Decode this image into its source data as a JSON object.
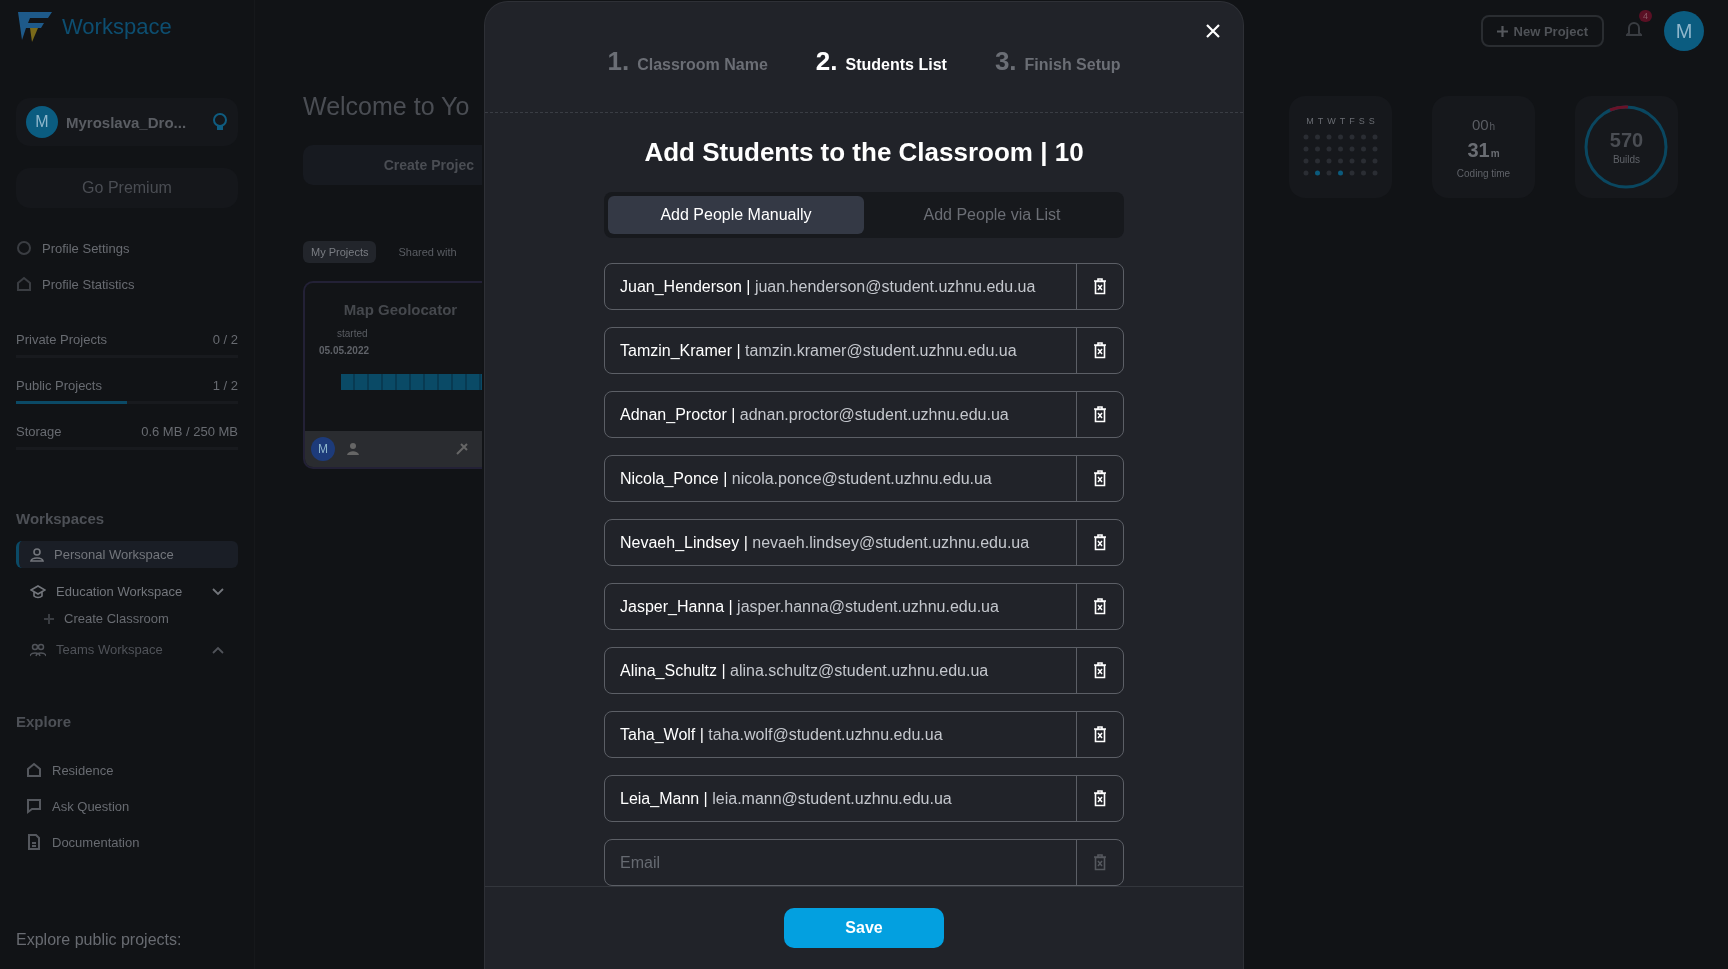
{
  "sidebar": {
    "logo": "Workspace",
    "user": {
      "avatar": "M",
      "name": "Myroslava_Dro..."
    },
    "premium": "Go Premium",
    "profile_links": [
      {
        "label": "Profile Settings",
        "kind": "settings"
      },
      {
        "label": "Profile Statistics",
        "kind": "stats"
      }
    ],
    "quotas": [
      {
        "label": "Private Projects",
        "value": "0 / 2"
      },
      {
        "label": "Public Projects",
        "value": "1 / 2",
        "level": 0.5
      },
      {
        "label": "Storage",
        "value": "0.6 MB / 250 MB"
      }
    ],
    "workspaces_heading": "Workspaces",
    "workspaces": [
      {
        "label": "Personal Workspace",
        "selected": true,
        "disabled": false,
        "kind": "person"
      },
      {
        "label": "Education Workspace",
        "selected": false,
        "disabled": false,
        "kind": "education",
        "expanded": true,
        "children": [
          {
            "label": "Create Classroom"
          }
        ]
      },
      {
        "label": "Teams Workspace",
        "selected": false,
        "disabled": true,
        "kind": "team",
        "expanded": false
      }
    ],
    "explore_heading": "Explore",
    "explore": [
      {
        "label": "Residence",
        "kind": "house"
      },
      {
        "label": "Ask Question",
        "kind": "chat"
      },
      {
        "label": "Documentation",
        "kind": "doc"
      }
    ],
    "public_heading": "Explore public projects:"
  },
  "main": {
    "welcome": "Welcome to Yo",
    "create": "Create Projec",
    "tabs": [
      {
        "label": "My Projects",
        "selected": true
      },
      {
        "label": "Shared with",
        "selected": false
      }
    ],
    "card": {
      "title": "Map Geolocator",
      "started_label": "started",
      "date": "05.05.2022",
      "avatar": "M"
    }
  },
  "topbar": {
    "new_project": "New Project",
    "notifications": "4",
    "avatar": "M"
  },
  "stats": {
    "days": [
      "M",
      "T",
      "W",
      "T",
      "F",
      "S",
      "S"
    ],
    "hours": "00",
    "hours_unit": "h",
    "minutes": "31",
    "minutes_unit": "m",
    "coding_label": "Coding time",
    "builds": "570",
    "builds_label": "Builds"
  },
  "modal": {
    "steps": [
      {
        "number": "1.",
        "label": "Classroom Name",
        "selected": false
      },
      {
        "number": "2.",
        "label": "Students List",
        "selected": true
      },
      {
        "number": "3.",
        "label": "Finish Setup",
        "selected": false
      }
    ],
    "title": "Add Students to the Classroom | 10",
    "tabs": [
      {
        "label": "Add People Manually",
        "selected": true
      },
      {
        "label": "Add People via List",
        "selected": false
      }
    ],
    "students": [
      {
        "value": "**Juan_Henderson |** juan.henderson@student.uzhnu.edu.ua"
      },
      {
        "value": "**Tamzin_Kramer |** tamzin.kramer@student.uzhnu.edu.ua"
      },
      {
        "value": "**Adnan_Proctor |** adnan.proctor@student.uzhnu.edu.ua"
      },
      {
        "value": "**Nicola_Ponce |** nicola.ponce@student.uzhnu.edu.ua"
      },
      {
        "value": "**Nevaeh_Lindsey |** nevaeh.lindsey@student.uzhnu.edu.ua"
      },
      {
        "value": "**Jasper_Hanna |** jasper.hanna@student.uzhnu.edu.ua"
      },
      {
        "value": "**Alina_Schultz |** alina.schultz@student.uzhnu.edu.ua"
      },
      {
        "value": "**Taha_Wolf |** taha.wolf@student.uzhnu.edu.ua"
      },
      {
        "value": "**Leia_Mann |** leia.mann@student.uzhnu.edu.ua"
      }
    ],
    "new_field": {
      "placeholder": "Email"
    },
    "save": "Save"
  }
}
